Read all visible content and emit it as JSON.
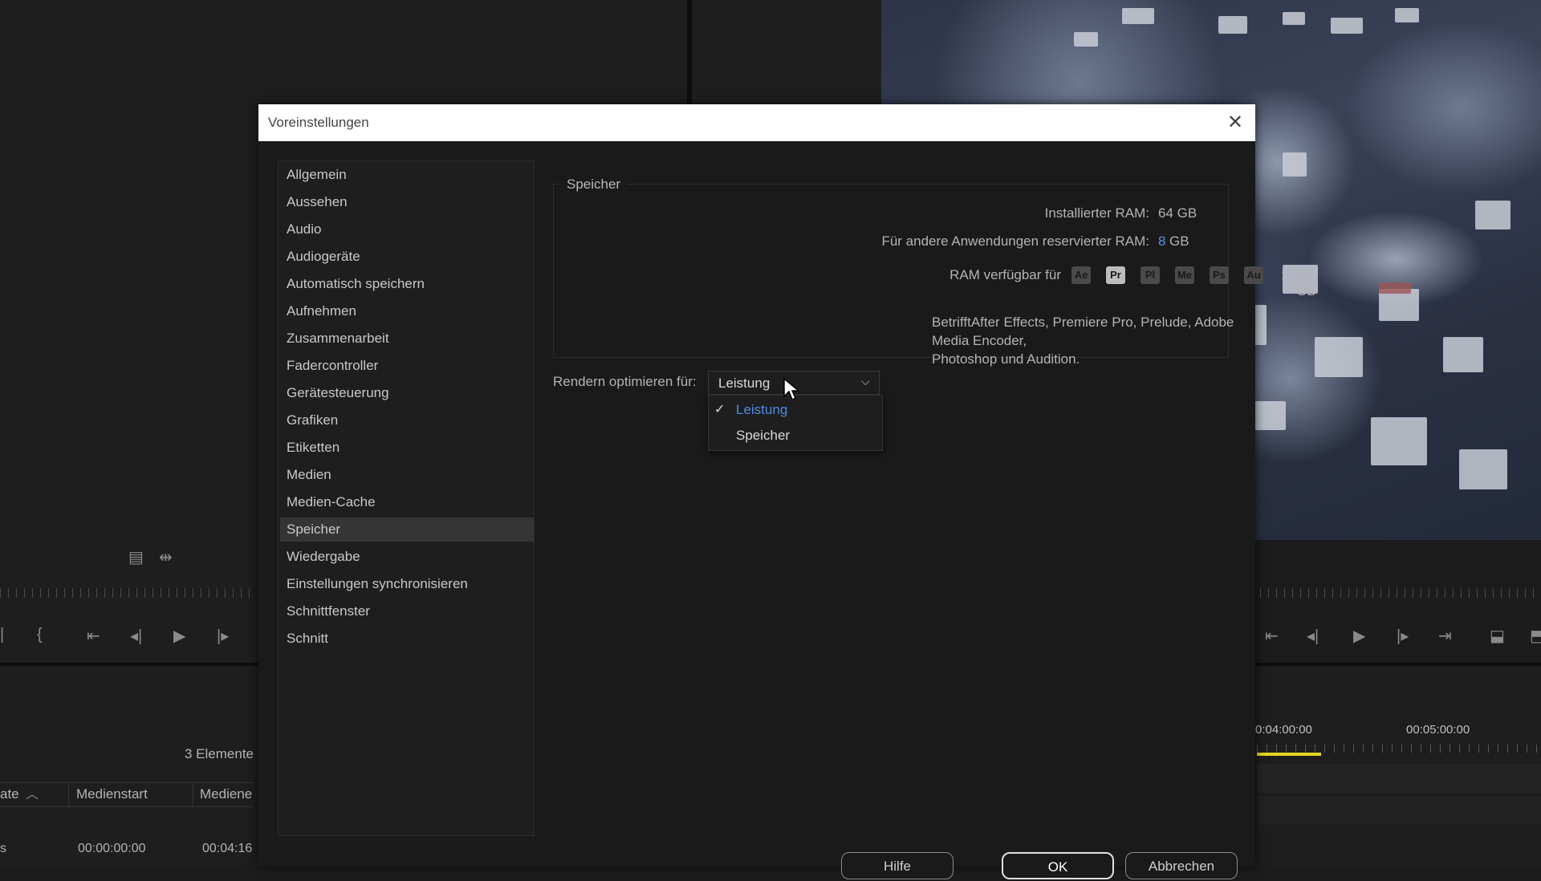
{
  "dialog": {
    "title": "Voreinstellungen",
    "close_icon": "close-icon",
    "nav": [
      {
        "label": "Allgemein"
      },
      {
        "label": "Aussehen"
      },
      {
        "label": "Audio"
      },
      {
        "label": "Audiogeräte"
      },
      {
        "label": "Automatisch speichern"
      },
      {
        "label": "Aufnehmen"
      },
      {
        "label": "Zusammenarbeit"
      },
      {
        "label": "Fadercontroller"
      },
      {
        "label": "Gerätesteuerung"
      },
      {
        "label": "Grafiken"
      },
      {
        "label": "Etiketten"
      },
      {
        "label": "Medien"
      },
      {
        "label": "Medien-Cache"
      },
      {
        "label": "Speicher",
        "selected": true
      },
      {
        "label": "Wiedergabe"
      },
      {
        "label": "Einstellungen synchronisieren"
      },
      {
        "label": "Schnittfenster"
      },
      {
        "label": "Schnitt"
      }
    ],
    "memory": {
      "group_title": "Speicher",
      "installed_label": "Installierter RAM:",
      "installed_value": "64 GB",
      "reserved_label": "Für andere Anwendungen reservierter RAM:",
      "reserved_number": "8",
      "reserved_unit": "GB",
      "available_label": "RAM verfügbar für",
      "apps": [
        "Ae",
        "Pr",
        "Pl",
        "Me",
        "Ps",
        "Au"
      ],
      "active_app": "Pr",
      "available_sep": ":",
      "available_value": "56 GB",
      "note_line1": "BetrifftAfter Effects, Premiere Pro, Prelude, Adobe Media Encoder,",
      "note_line2": "Photoshop und Audition."
    },
    "render": {
      "label": "Rendern optimieren für:",
      "selected": "Leistung",
      "chevron_icon": "chevron-down-icon",
      "options": [
        {
          "label": "Leistung",
          "checked": true,
          "check": "✓"
        },
        {
          "label": "Speicher",
          "checked": false,
          "check": ""
        }
      ]
    },
    "buttons": {
      "help": "Hilfe",
      "ok": "OK",
      "cancel": "Abbrechen"
    }
  },
  "background": {
    "project_count": "3 Elemente",
    "columns": [
      "ate",
      "Medienstart",
      "Mediene"
    ],
    "row": {
      "c0": "s",
      "c1": "00:00:00:00",
      "c2": "00:04:16"
    },
    "timeline_codes": [
      "0:04:00:00",
      "00:05:00:00"
    ]
  }
}
